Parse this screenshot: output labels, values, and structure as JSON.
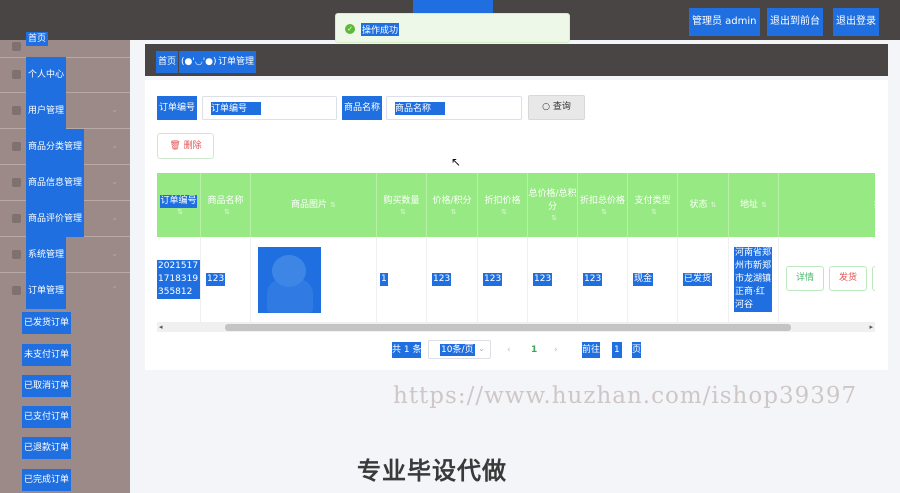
{
  "toast": {
    "message": "操作成功"
  },
  "header": {
    "admin_label": "管理员 admin",
    "to_front": "退出到前台",
    "logout": "退出登录"
  },
  "sidebar": {
    "items": [
      {
        "label": "首页"
      },
      {
        "label": "个人中心"
      },
      {
        "label": "用户管理"
      },
      {
        "label": "商品分类管理"
      },
      {
        "label": "商品信息管理"
      },
      {
        "label": "商品评价管理"
      },
      {
        "label": "系统管理"
      },
      {
        "label": "订单管理"
      }
    ],
    "subitems": [
      {
        "label": "已发货订单"
      },
      {
        "label": "未支付订单"
      },
      {
        "label": "已取消订单"
      },
      {
        "label": "已支付订单"
      },
      {
        "label": "已退款订单"
      },
      {
        "label": "已完成订单"
      }
    ]
  },
  "breadcrumb": {
    "home": "首页",
    "face": "(●'◡'●)",
    "current": "订单管理"
  },
  "search": {
    "order_no_label": "订单编号",
    "order_no_placeholder": "订单编号",
    "product_name_label": "商品名称",
    "product_name_placeholder": "商品名称",
    "query_button": "查询"
  },
  "actions": {
    "delete_button": "删除"
  },
  "table": {
    "columns": [
      "订单编号",
      "商品名称",
      "商品图片",
      "购买数量",
      "价格/积分",
      "折扣价格",
      "总价格/总积分",
      "折扣总价格",
      "支付类型",
      "状态",
      "地址",
      "操作"
    ],
    "rows": [
      {
        "order_no": "20215171718319355812",
        "product_name": "123",
        "quantity": "1",
        "price": "123",
        "discount_price": "123",
        "total": "123",
        "discount_total": "123",
        "pay_type": "现金",
        "status": "已发货",
        "address": "河南省郑州市新郑市龙湖镇正商·红河谷",
        "detail_button": "详情",
        "ship_button": "发货"
      }
    ]
  },
  "pagination": {
    "total": "共 1 条",
    "page_size": "10条/页",
    "current_page": "1",
    "goto_label": "前往",
    "goto_value": "1",
    "page_unit": "页"
  },
  "watermark": {
    "url": "https://www.huzhan.com/ishop39397",
    "text": "专业毕设代做"
  },
  "colors": {
    "header_bg": "#4a4545",
    "sidebar_bg": "#9b8a88",
    "table_header_bg": "#97e983",
    "selection": "#1f6fe0"
  }
}
